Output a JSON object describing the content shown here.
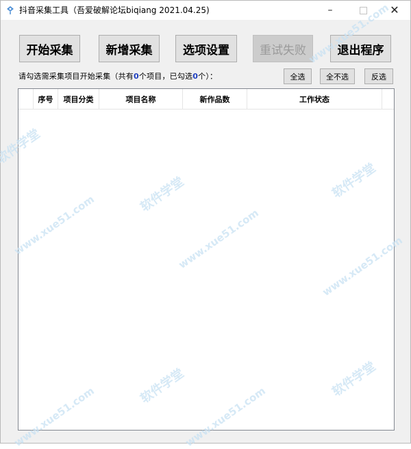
{
  "window": {
    "title": "抖音采集工具（吾爱破解论坛biqiang 2021.04.25)",
    "minimize": "–",
    "close": "✕"
  },
  "toolbar": {
    "start_label": "开始采集",
    "add_label": "新增采集",
    "options_label": "选项设置",
    "retry_label": "重试失败",
    "exit_label": "退出程序"
  },
  "status": {
    "prefix": "请勾选需采集项目开始采集（共有",
    "total": "0",
    "middle": "个项目，已勾选",
    "selected": "0",
    "suffix": "个）："
  },
  "selection": {
    "select_all": "全选",
    "select_none": "全不选",
    "invert": "反选"
  },
  "table": {
    "columns": [
      "",
      "序号",
      "项目分类",
      "项目名称",
      "新作品数",
      "工作状态",
      ""
    ],
    "rows": []
  },
  "watermarks": [
    "软件学堂",
    "www.xue51.com"
  ]
}
